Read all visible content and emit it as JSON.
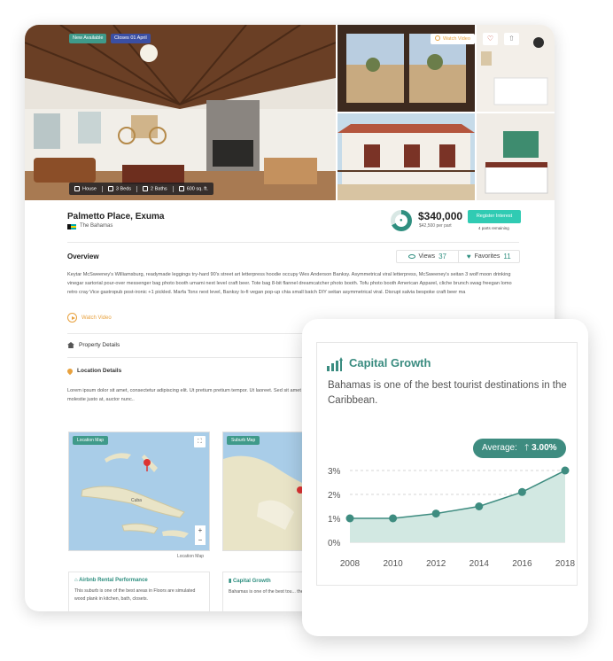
{
  "listing": {
    "badges": {
      "new": "New Available",
      "closes": "Closes 01 April"
    },
    "specs": {
      "type": "House",
      "beds": "3 Beds",
      "baths": "2 Baths",
      "area": "600 sq. ft."
    },
    "watch_top_label": "Watch Video",
    "title": "Palmetto Place, Exuma",
    "country": "The Bahamas",
    "price": "$340,000",
    "per_part": "$42,500 per part",
    "register_label": "Register Interest",
    "parts_remaining": "4 parts remaining"
  },
  "overview": {
    "heading": "Overview",
    "views_label": "Views",
    "views_count": "37",
    "favorites_label": "Favorites",
    "favorites_count": "11",
    "description": "Keytar McSweeney's Williamsburg, readymade leggings try-hard 90's street art letterpress hoodie occupy Wes Anderson Banksy. Asymmetrical viral letterpress, McSweeney's seitan 3 wolf moon drinking vinegar sartorial pour-over messenger bag photo booth umami next level craft beer. Tote bag 8-bit flannel dreamcatcher photo booth. Tofu photo booth American Apparel, cliche brunch swag freegan lomo retro cray Vice gastropub post-ironic +1 pickled. Marfa Tonx next level, Banksy lo-fi vegan pop-up chia small batch DIY seitan asymmetrical viral. Disrupt salvia bespoke craft beer ma",
    "watch_video": "Watch Video"
  },
  "property_details": "Property Details",
  "location": {
    "heading": "Location Details",
    "description": "Lorem ipsum dolor sit amet, consectetur adipiscing elit. Ut pretium pretium tempor. Ut laoreet. Sed sit amet arcu aliquet, molestie justo at, auctor nunc..",
    "map_tag": "Location Map",
    "suburb_tag": "Suburb Map",
    "map_caption": "Location Map",
    "map_labels": {
      "cuba": "Cuba"
    }
  },
  "bottom_cards": {
    "airbnb_title": "Airbnb Rental Performance",
    "airbnb_text": "This suburb is one of the best areas in Floors are simulated wood plank in kitchen, bath, closets.",
    "capital_title": "Capital Growth",
    "capital_text": "Bahamas is one of the best tou... the Caribbean."
  },
  "capital_growth_card": {
    "title": "Capital Growth",
    "description": "Bahamas is one of the best tourist destinations in the Caribbean.",
    "average_label": "Average:",
    "average_value": "3.00%"
  },
  "colors": {
    "accent": "#3e8c80",
    "register": "#30cbb3",
    "orange": "#e8a13e",
    "badge_blue": "#3b4fa3"
  },
  "chart_data": {
    "type": "area",
    "title": "Capital Growth",
    "x": [
      2008,
      2010,
      2012,
      2014,
      2016,
      2018
    ],
    "values": [
      1.0,
      1.0,
      1.2,
      1.5,
      2.1,
      3.0
    ],
    "ylim": [
      0,
      3
    ],
    "y_ticks": [
      "0%",
      "1%",
      "2%",
      "3%"
    ],
    "grid": true
  }
}
